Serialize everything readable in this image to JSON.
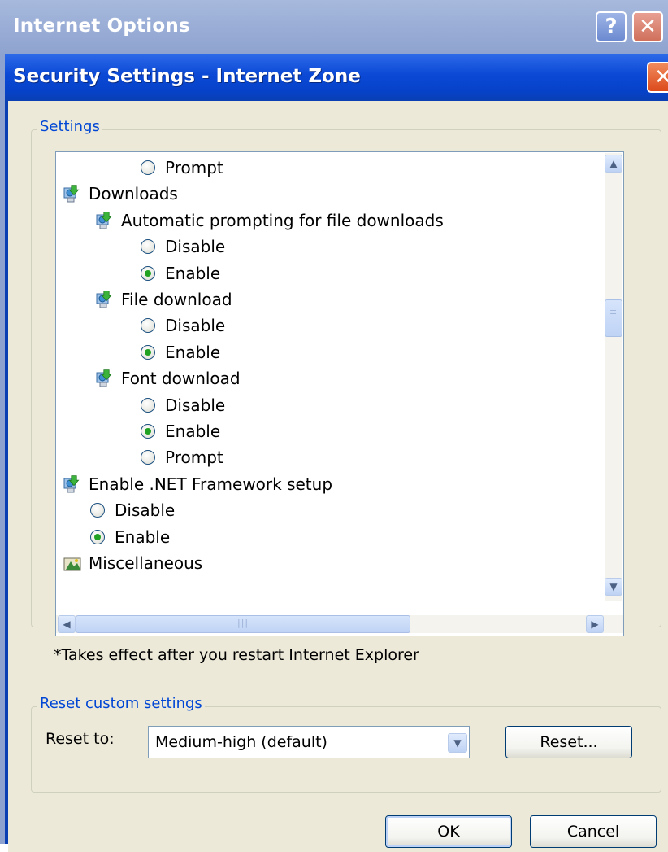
{
  "outer_window": {
    "title": "Internet Options",
    "help_glyph": "?",
    "close_glyph": "✕"
  },
  "dialog": {
    "title": "Security Settings - Internet Zone",
    "close_glyph": "✕"
  },
  "settings_group": {
    "legend": "Settings",
    "items": [
      {
        "kind": "radio",
        "label": "Prompt",
        "checked": false,
        "level": 2
      },
      {
        "kind": "folder",
        "label": "Downloads",
        "level": 0,
        "icon": "settings-folder-icon"
      },
      {
        "kind": "folder",
        "label": "Automatic prompting for file downloads",
        "level": 1,
        "icon": "settings-folder-icon"
      },
      {
        "kind": "radio",
        "label": "Disable",
        "checked": false,
        "level": 2
      },
      {
        "kind": "radio",
        "label": "Enable",
        "checked": true,
        "level": 2
      },
      {
        "kind": "folder",
        "label": "File download",
        "level": 1,
        "icon": "settings-folder-icon"
      },
      {
        "kind": "radio",
        "label": "Disable",
        "checked": false,
        "level": 2
      },
      {
        "kind": "radio",
        "label": "Enable",
        "checked": true,
        "level": 2
      },
      {
        "kind": "folder",
        "label": "Font download",
        "level": 1,
        "icon": "settings-folder-icon"
      },
      {
        "kind": "radio",
        "label": "Disable",
        "checked": false,
        "level": 2
      },
      {
        "kind": "radio",
        "label": "Enable",
        "checked": true,
        "level": 2
      },
      {
        "kind": "radio",
        "label": "Prompt",
        "checked": false,
        "level": 2
      },
      {
        "kind": "folder",
        "label": "Enable .NET Framework setup",
        "level": 0,
        "icon": "settings-folder-icon"
      },
      {
        "kind": "radio",
        "label": "Disable",
        "checked": false,
        "level": 1
      },
      {
        "kind": "radio",
        "label": "Enable",
        "checked": true,
        "level": 1
      },
      {
        "kind": "folder",
        "label": "Miscellaneous",
        "level": 0,
        "icon": "misc-folder-icon"
      }
    ],
    "note": "*Takes effect after you restart Internet Explorer"
  },
  "reset_group": {
    "legend": "Reset custom settings",
    "reset_to_label": "Reset to:",
    "selected_level": "Medium-high (default)",
    "reset_button": "Reset..."
  },
  "footer": {
    "ok": "OK",
    "cancel": "Cancel"
  },
  "colors": {
    "title_blue": "#0b49d6",
    "face": "#ece9d8",
    "legend_blue": "#0046d5",
    "radio_green": "#21a121"
  }
}
